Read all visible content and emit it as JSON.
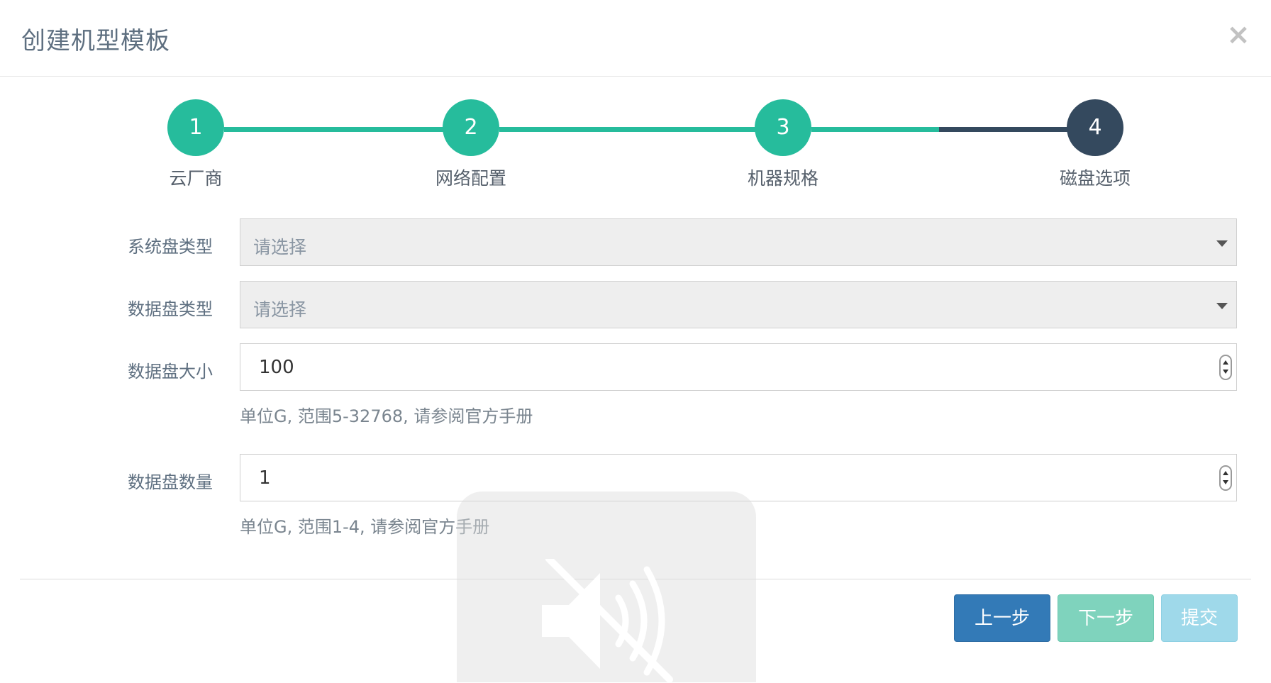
{
  "dialog": {
    "title": "创建机型模板",
    "close_label": "×"
  },
  "stepper": {
    "steps": [
      {
        "number": "1",
        "label": "云厂商"
      },
      {
        "number": "2",
        "label": "网络配置"
      },
      {
        "number": "3",
        "label": "机器规格"
      },
      {
        "number": "4",
        "label": "磁盘选项"
      }
    ],
    "current_step": 4,
    "colors": {
      "done": "#26bc9c",
      "active": "#34495e"
    }
  },
  "form": {
    "system_disk_type": {
      "label": "系统盘类型",
      "placeholder": "请选择"
    },
    "data_disk_type": {
      "label": "数据盘类型",
      "placeholder": "请选择"
    },
    "data_disk_size": {
      "label": "数据盘大小",
      "value": "100",
      "help": "单位G, 范围5-32768, 请参阅官方手册"
    },
    "data_disk_count": {
      "label": "数据盘数量",
      "value": "1",
      "help": "单位G, 范围1-4, 请参阅官方手册"
    }
  },
  "footer": {
    "prev_label": "上一步",
    "next_label": "下一步",
    "submit_label": "提交"
  },
  "overlay": {
    "icon": "muted-speaker-icon"
  }
}
